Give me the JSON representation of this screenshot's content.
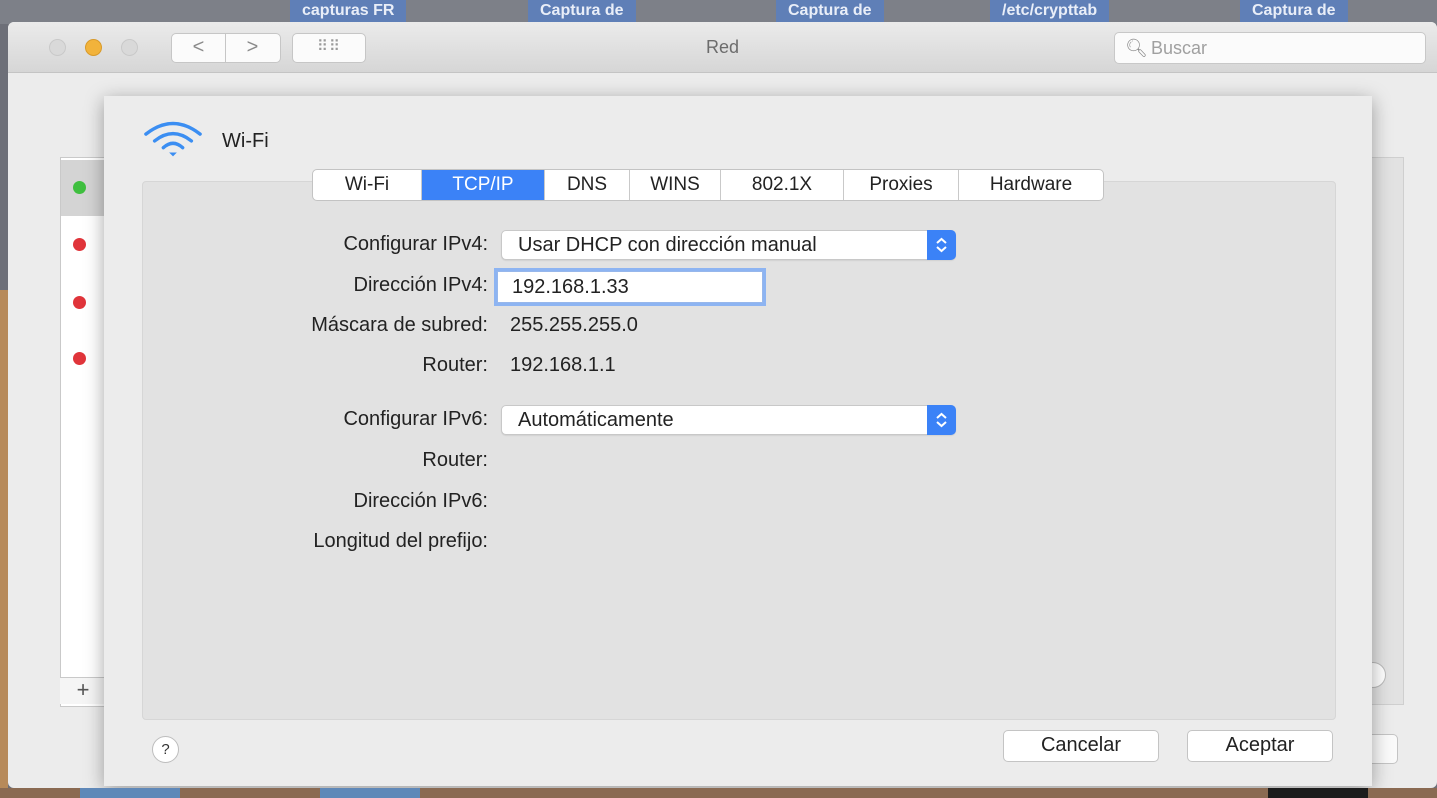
{
  "desktop": {
    "labels": [
      "capturas FR",
      "Captura de",
      "Captura de",
      "/etc/crypttab",
      "Captura de"
    ]
  },
  "window": {
    "title": "Red",
    "search_placeholder": "Buscar",
    "nav_back": "<",
    "nav_forward": ">",
    "grid_glyph": "⠿⠿"
  },
  "sheet": {
    "service_name": "Wi-Fi",
    "tabs": [
      {
        "label": "Wi-Fi",
        "active": false
      },
      {
        "label": "TCP/IP",
        "active": true
      },
      {
        "label": "DNS",
        "active": false
      },
      {
        "label": "WINS",
        "active": false
      },
      {
        "label": "802.1X",
        "active": false
      },
      {
        "label": "Proxies",
        "active": false
      },
      {
        "label": "Hardware",
        "active": false
      }
    ],
    "ipv4": {
      "configure_label": "Configurar IPv4:",
      "configure_value": "Usar DHCP con dirección manual",
      "address_label": "Dirección IPv4:",
      "address_value": "192.168.1.33",
      "subnet_label": "Máscara de subred:",
      "subnet_value": "255.255.255.0",
      "router_label": "Router:",
      "router_value": "192.168.1.1"
    },
    "ipv6": {
      "configure_label": "Configurar IPv6:",
      "configure_value": "Automáticamente",
      "router_label": "Router:",
      "address_label": "Dirección IPv6:",
      "prefix_label": "Longitud del prefijo:"
    },
    "help_label": "?",
    "cancel_label": "Cancelar",
    "accept_label": "Aceptar"
  },
  "background": {
    "add_label": "+",
    "service_status_colors": [
      "#3fbf3f",
      "#e0343a",
      "#e0343a",
      "#e0343a"
    ]
  },
  "colors": {
    "accent": "#3b82f7"
  }
}
